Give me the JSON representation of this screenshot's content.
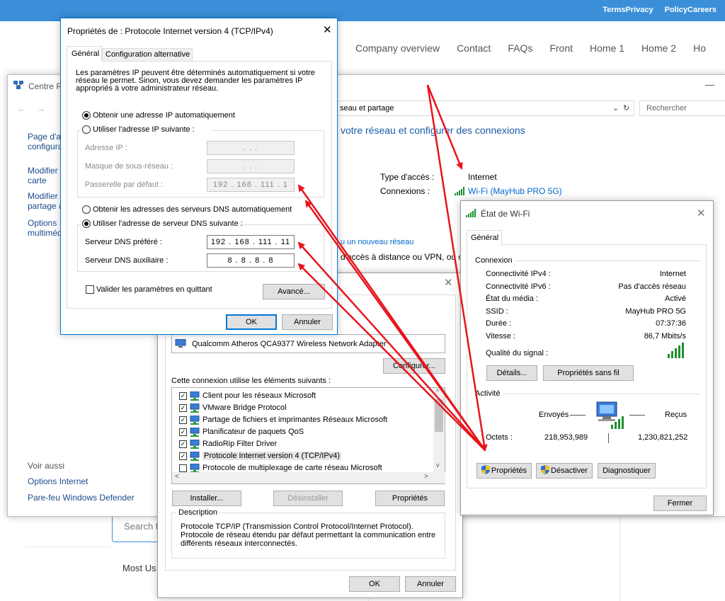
{
  "site": {
    "top_links": [
      "TermsPrivacy",
      "PolicyCareers"
    ],
    "nav": [
      "Company overview",
      "Contact",
      "FAQs",
      "Front",
      "Home 1",
      "Home 2",
      "Ho"
    ],
    "search_placeholder": "Search f",
    "most_used": "Most Us"
  },
  "centre": {
    "title": "Centre Ré",
    "minimize": "—",
    "address": "seau et partage",
    "search_placeholder": "Rechercher",
    "heading": "votre réseau et configurer des connexions",
    "sidebar": [
      "Page d'ac",
      "configura",
      "Modifier",
      "carte",
      "Modifier",
      "partage a",
      "Options",
      "multiméd"
    ],
    "access_type_label": "Type d'accès :",
    "access_type_value": "Internet",
    "connections_label": "Connexions :",
    "connections_value": "Wi-Fi (MayHub PRO 5G)",
    "new_network": "u un nouveau réseau",
    "remote_access": "d'accès à distance ou VPN, ou co",
    "see_also": "Voir aussi",
    "see_also_links": [
      "Options Internet",
      "Pare-feu Windows Defender"
    ]
  },
  "tcp": {
    "title": "Propriétés de : Protocole Internet version 4 (TCP/IPv4)",
    "tabs": [
      "Général",
      "Configuration alternative"
    ],
    "info": "Les paramètres IP peuvent être déterminés automatiquement si votre réseau le permet. Sinon, vous devez demander les paramètres IP appropriés à votre administrateur réseau.",
    "radio_auto_ip": "Obtenir une adresse IP automatiquement",
    "radio_manual_ip": "Utiliser l'adresse IP suivante :",
    "ip_label": "Adresse IP :",
    "mask_label": "Masque de sous-réseau :",
    "gateway_label": "Passerelle par défaut :",
    "ip_value": ". . .",
    "mask_value": ". . .",
    "gateway_value": "192 . 168 . 111 . 1",
    "radio_auto_dns": "Obtenir les adresses des serveurs DNS automatiquement",
    "radio_manual_dns": "Utiliser l'adresse de serveur DNS suivante :",
    "dns_pref_label": "Serveur DNS préféré :",
    "dns_aux_label": "Serveur DNS auxiliaire :",
    "dns_pref_value": "192 . 168 . 111 . 11",
    "dns_aux_value": "8 . 8 . 8 . 8",
    "validate_label": "Valider les paramètres en quittant",
    "advanced": "Avancé...",
    "ok": "OK",
    "cancel": "Annuler"
  },
  "wifiprops": {
    "adapter": "Qualcomm Atheros QCA9377 Wireless Network Adapter",
    "configure": "Configurer...",
    "uses_label": "Cette connexion utilise les éléments suivants :",
    "items": [
      {
        "label": "Client pour les réseaux Microsoft",
        "checked": true
      },
      {
        "label": "VMware Bridge Protocol",
        "checked": true
      },
      {
        "label": "Partage de fichiers et imprimantes Réseaux Microsoft",
        "checked": true
      },
      {
        "label": "Planificateur de paquets QoS",
        "checked": true
      },
      {
        "label": "RadioRip Filter Driver",
        "checked": true
      },
      {
        "label": "Protocole Internet version 4 (TCP/IPv4)",
        "checked": true
      },
      {
        "label": "Protocole de multiplexage de carte réseau Microsoft",
        "checked": false
      }
    ],
    "install": "Installer...",
    "uninstall": "Désinstaller",
    "properties": "Propriétés",
    "description_title": "Description",
    "description": "Protocole TCP/IP (Transmission Control Protocol/Internet Protocol). Protocole de réseau étendu par défaut permettant la communication entre différents réseaux interconnectés.",
    "ok": "OK",
    "cancel": "Annuler"
  },
  "etat": {
    "title": "État de Wi-Fi",
    "tab": "Général",
    "connection_group": "Connexion",
    "rows": [
      {
        "label": "Connectivité IPv4 :",
        "value": "Internet"
      },
      {
        "label": "Connectivité IPv6 :",
        "value": "Pas d'accès réseau"
      },
      {
        "label": "État du média :",
        "value": "Activé"
      },
      {
        "label": "SSID :",
        "value": "MayHub PRO 5G"
      },
      {
        "label": "Durée :",
        "value": "07:37:36"
      },
      {
        "label": "Vitesse :",
        "value": "86,7 Mbits/s"
      }
    ],
    "signal_label": "Qualité du signal :",
    "details": "Détails...",
    "wireless_props": "Propriétés sans fil",
    "activity_group": "Activité",
    "sent": "Envoyés",
    "received": "Reçus",
    "octets_label": "Octets :",
    "sent_value": "218,953,989",
    "received_value": "1,230,821,252",
    "properties": "Propriétés",
    "disable": "Désactiver",
    "diagnose": "Diagnostiquer",
    "close": "Fermer"
  },
  "colors": {
    "arrow": "#e8141c",
    "link": "#1a5ba6",
    "accent": "#3a8fd8"
  }
}
